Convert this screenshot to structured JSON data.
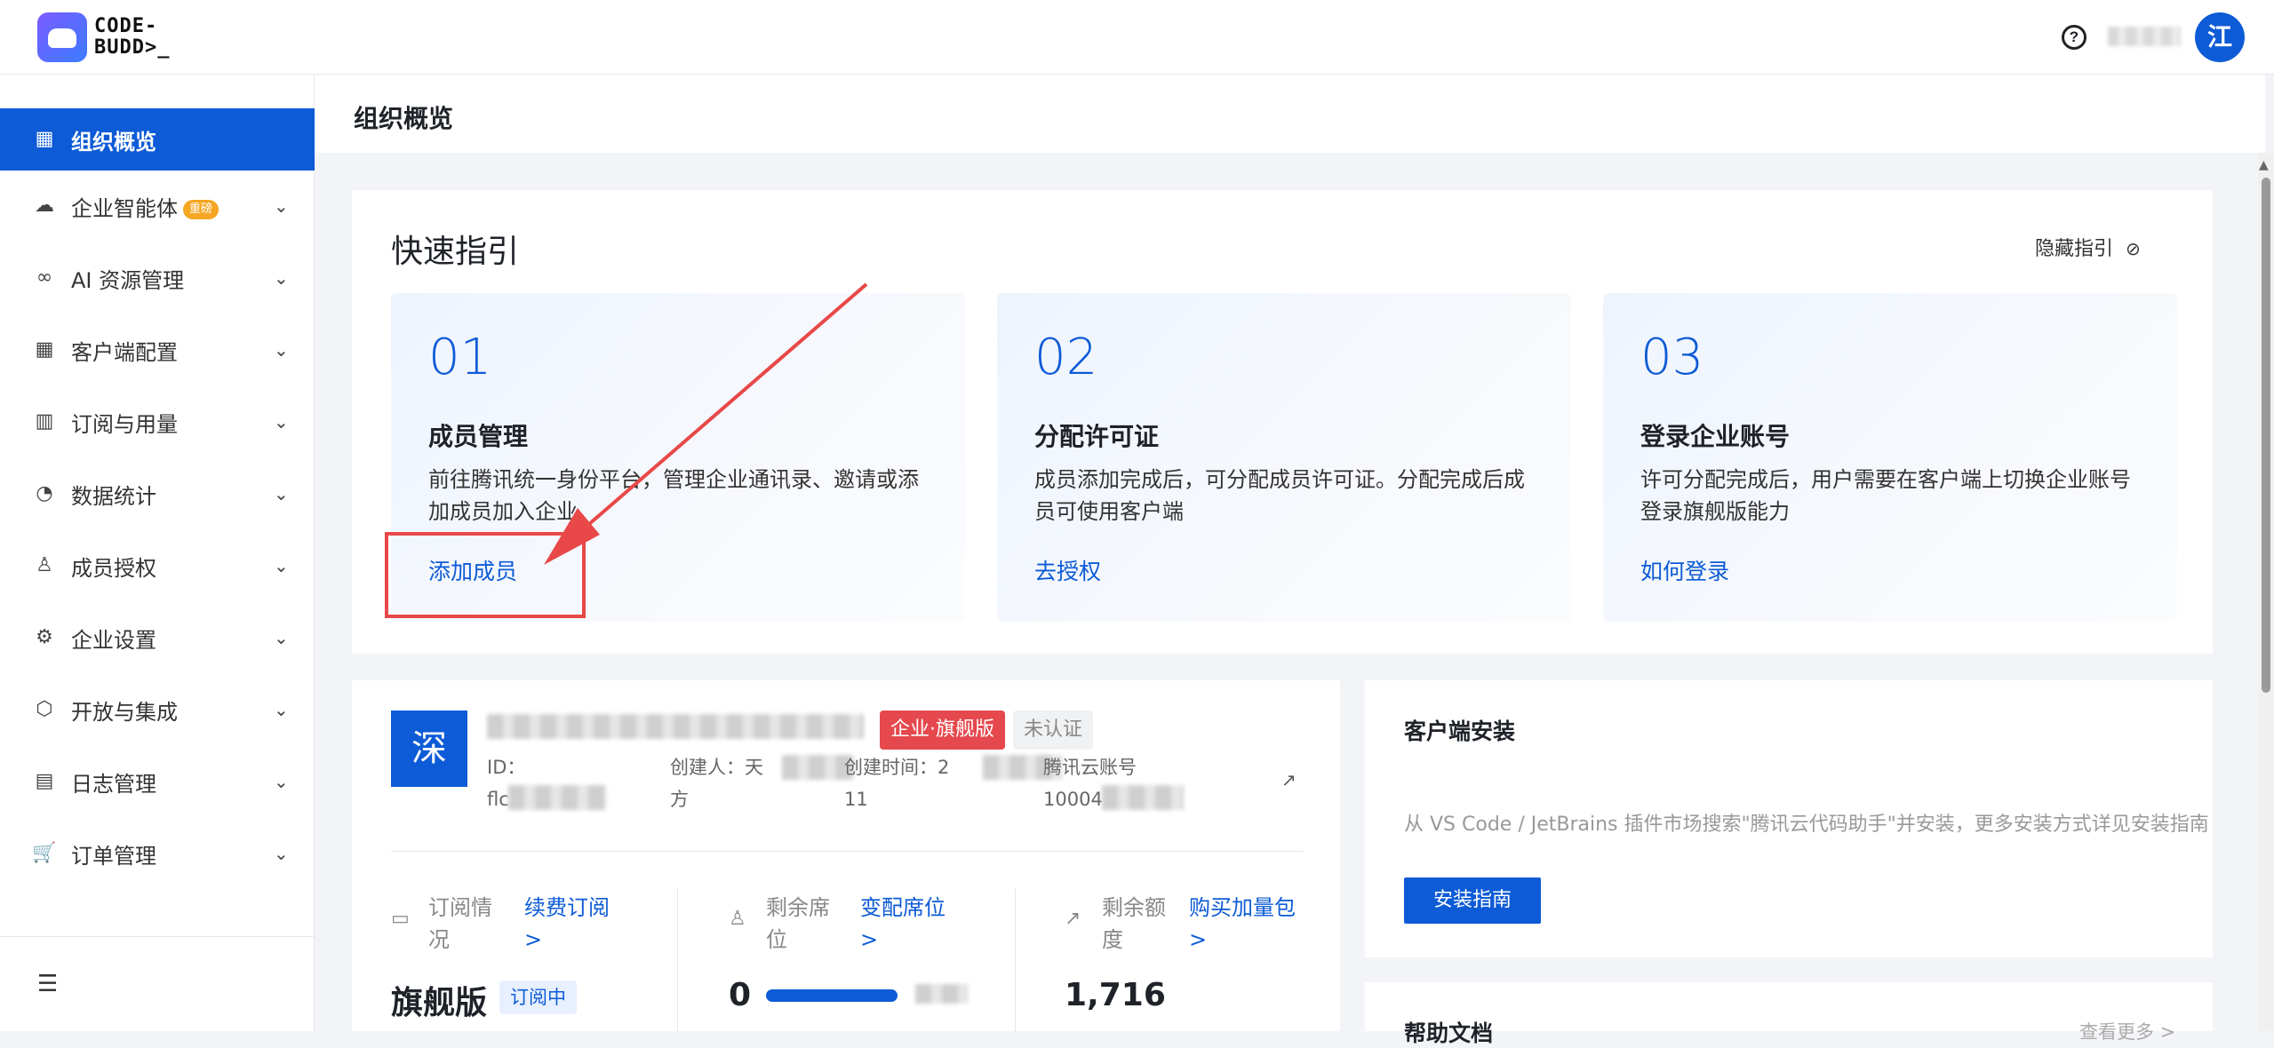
{
  "header": {
    "logo_text": "CODE-\nBUDD>_",
    "help_icon": "?",
    "avatar_initial": "江"
  },
  "sidebar": {
    "items": [
      {
        "label": "组织概览",
        "icon": "grid-icon",
        "glyph": "▦",
        "active": true
      },
      {
        "label": "企业智能体",
        "icon": "cloud-icon",
        "glyph": "☁",
        "badge": "重磅"
      },
      {
        "label": "AI 资源管理",
        "icon": "infinity-icon",
        "glyph": "∞"
      },
      {
        "label": "客户端配置",
        "icon": "apps-icon",
        "glyph": "▦"
      },
      {
        "label": "订阅与用量",
        "icon": "bar-chart-icon",
        "glyph": "▥"
      },
      {
        "label": "数据统计",
        "icon": "pie-chart-icon",
        "glyph": "◔"
      },
      {
        "label": "成员授权",
        "icon": "user-icon",
        "glyph": "♙"
      },
      {
        "label": "企业设置",
        "icon": "settings-icon",
        "glyph": "⚙"
      },
      {
        "label": "开放与集成",
        "icon": "cube-icon",
        "glyph": "⬡"
      },
      {
        "label": "日志管理",
        "icon": "calendar-icon",
        "glyph": "▤"
      },
      {
        "label": "订单管理",
        "icon": "cart-icon",
        "glyph": "🛒"
      }
    ],
    "chevron": "⌄",
    "collapse_icon": "☰"
  },
  "page": {
    "title": "组织概览"
  },
  "quick_guide": {
    "title": "快速指引",
    "hide_label": "隐藏指引",
    "steps": [
      {
        "num": "01",
        "title": "成员管理",
        "desc": "前往腾讯统一身份平台，管理企业通讯录、邀请或添加成员加入企业",
        "link": "添加成员"
      },
      {
        "num": "02",
        "title": "分配许可证",
        "desc": "成员添加完成后，可分配成员许可证。分配完成后成员可使用客户端",
        "link": "去授权"
      },
      {
        "num": "03",
        "title": "登录企业账号",
        "desc": "许可分配完成后，用户需要在客户端上切换企业账号登录旗舰版能力",
        "link": "如何登录"
      }
    ]
  },
  "org": {
    "logo_char": "深",
    "tag_edition": "企业·旗舰版",
    "tag_cert": "未认证",
    "id_label": "ID：",
    "id_value": "flc",
    "creator_label": "创建人：天",
    "creator_tail": "方",
    "created_label": "创建时间：2",
    "created_tail": "11",
    "account_label": "腾讯云账号",
    "account_value": "10004",
    "stats": [
      {
        "label": "订阅情况",
        "link": "续费订阅 >",
        "value": "旗舰版",
        "badge": "订阅中"
      },
      {
        "label": "剩余席位",
        "link": "变配席位 >",
        "value": "0",
        "progress": 1.0
      },
      {
        "label": "剩余额度",
        "link": "购买加量包 >",
        "value": "1,716"
      }
    ]
  },
  "client_install": {
    "title": "客户端安装",
    "desc": "从 VS Code / JetBrains 插件市场搜索\"腾讯云代码助手\"并安装，更多安装方式详见安装指南",
    "button": "安装指南"
  },
  "help_docs": {
    "title": "帮助文档",
    "more": "查看更多 >"
  },
  "colors": {
    "primary": "#0d5bd6",
    "highlight": "#e84848",
    "tag_red": "#e5484d"
  }
}
